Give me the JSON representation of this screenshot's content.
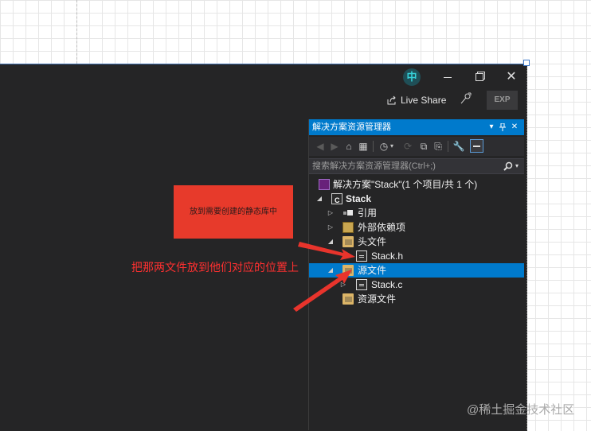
{
  "title_bar": {
    "ime_indicator": "中",
    "minimize_icon": "minimize-icon",
    "restore_icon": "restore-icon",
    "close_icon": "close-icon"
  },
  "toolbar_top": {
    "live_share_label": "Live Share",
    "feedback_icon": "feedback-icon",
    "exp_badge": "EXP"
  },
  "solution_explorer": {
    "title": "解决方案资源管理器",
    "title_controls": [
      "▾",
      "ᴉ",
      "✕"
    ],
    "search_placeholder": "搜索解决方案资源管理器(Ctrl+;)",
    "tree": [
      {
        "label": "解决方案\"Stack\"(1 个项目/共 1 个)",
        "expander": "",
        "icon": "solution-icon"
      },
      {
        "label": "Stack",
        "expander": "◢",
        "icon": "cpp-project-icon"
      },
      {
        "label": "引用",
        "expander": "▷",
        "icon": "references-icon"
      },
      {
        "label": "外部依赖项",
        "expander": "▷",
        "icon": "external-deps-icon"
      },
      {
        "label": "头文件",
        "expander": "◢",
        "icon": "folder-icon"
      },
      {
        "label": "Stack.h",
        "expander": "",
        "icon": "header-file-icon"
      },
      {
        "label": "源文件",
        "expander": "◢",
        "icon": "folder-icon",
        "selected": true
      },
      {
        "label": "Stack.c",
        "expander": "▷",
        "icon": "source-file-icon"
      },
      {
        "label": "资源文件",
        "expander": "",
        "icon": "folder-icon"
      }
    ]
  },
  "annotations": {
    "callout_text": "放到需要创建的静态库中",
    "instruction_text": "把那两文件放到他们对应的位置上",
    "arrow_color": "#e8342c"
  },
  "watermark": "@稀土掘金技术社区",
  "colors": {
    "accent": "#007acc",
    "ide_background": "#252526",
    "callout_fill": "#e73a2b"
  }
}
